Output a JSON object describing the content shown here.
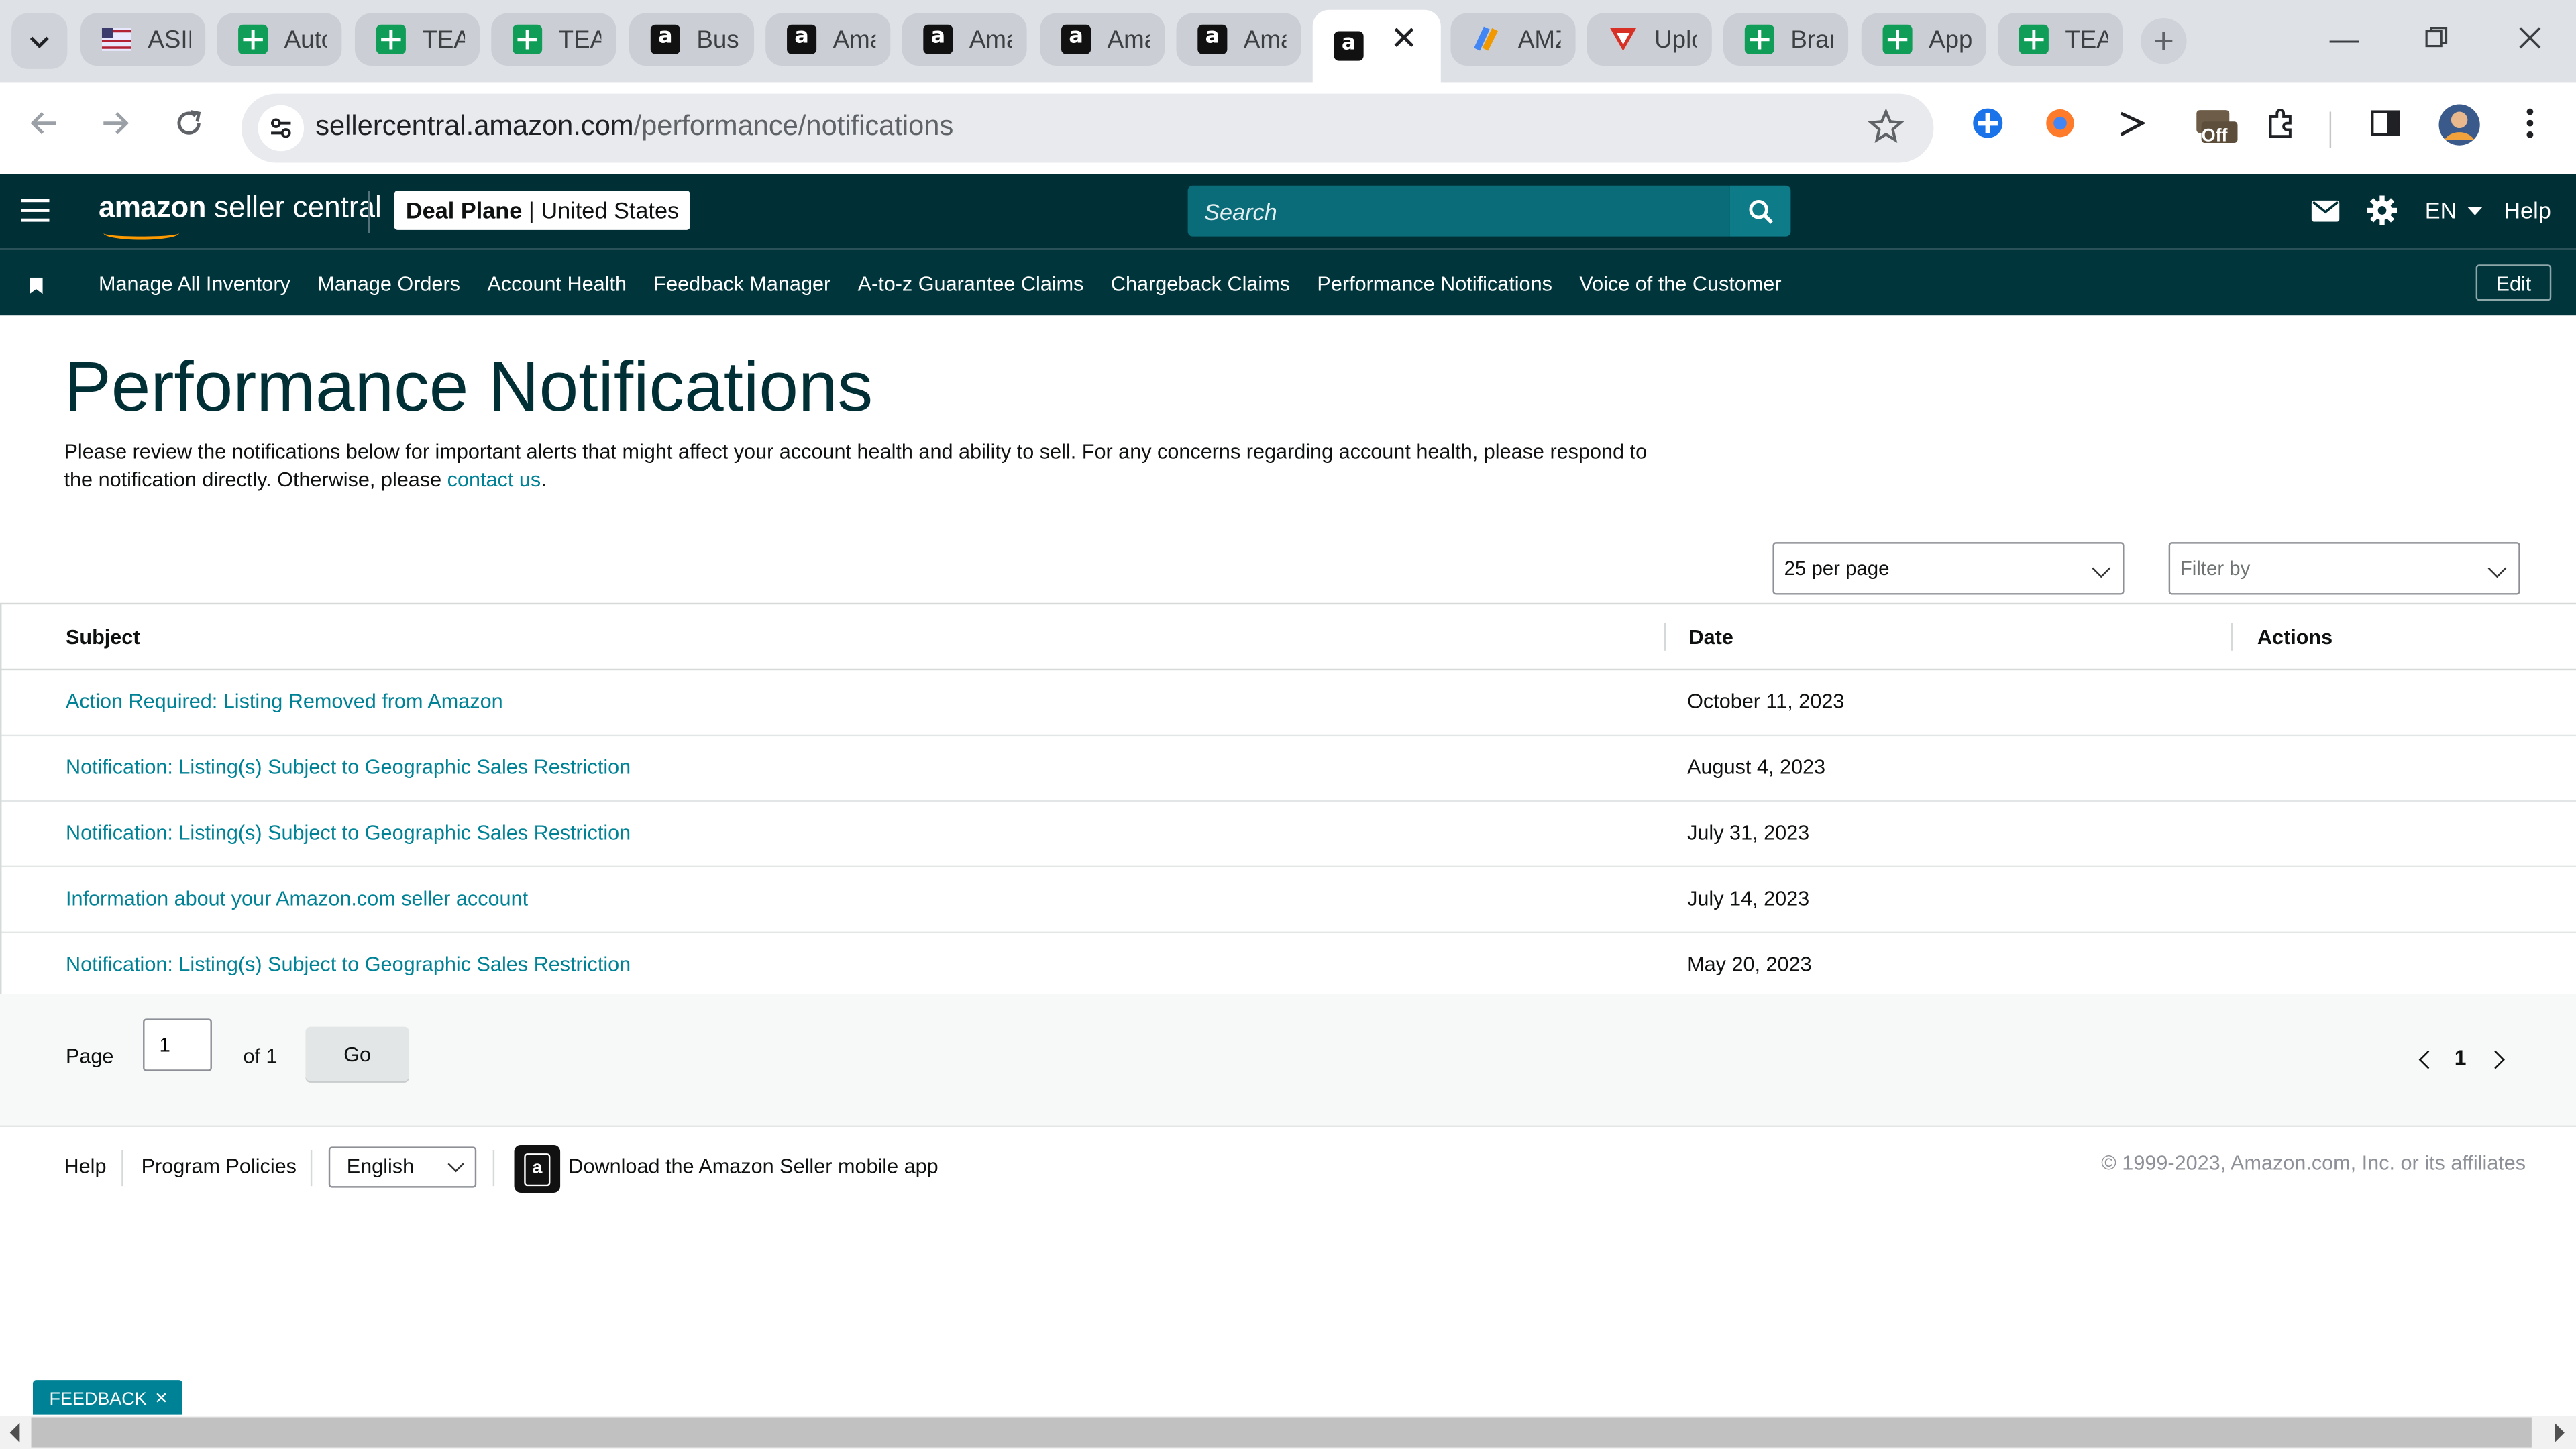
{
  "browser": {
    "tabs": [
      {
        "title": "ASIN",
        "icon": "asin-favicon-icon"
      },
      {
        "title": "Auto",
        "icon": "sheets-icon"
      },
      {
        "title": "TEAM",
        "icon": "sheets-icon"
      },
      {
        "title": "TEAM",
        "icon": "sheets-icon"
      },
      {
        "title": "Busi",
        "icon": "amazon-icon"
      },
      {
        "title": "Ama",
        "icon": "amazon-icon"
      },
      {
        "title": "Ama",
        "icon": "amazon-icon"
      },
      {
        "title": "Ama",
        "icon": "amazon-icon"
      },
      {
        "title": "Ama",
        "icon": "amazon-icon"
      },
      {
        "title": "",
        "icon": "amazon-icon",
        "active": true
      },
      {
        "title": "AMZ",
        "icon": "app-icon"
      },
      {
        "title": "Uplo",
        "icon": "upload-icon"
      },
      {
        "title": "Bran",
        "icon": "sheets-icon"
      },
      {
        "title": "App",
        "icon": "sheets-icon"
      },
      {
        "title": "TEAM",
        "icon": "sheets-icon"
      }
    ],
    "url_host": "sellercentral.amazon.com",
    "url_path": "/performance/notifications",
    "extension_badge": "Off"
  },
  "header": {
    "logo_bold": "amazon",
    "logo_light": "seller central",
    "account_name": "Deal Plane",
    "marketplace": "United States",
    "search_placeholder": "Search",
    "language": "EN",
    "help": "Help"
  },
  "nav": {
    "items": [
      "Manage All Inventory",
      "Manage Orders",
      "Account Health",
      "Feedback Manager",
      "A-to-z Guarantee Claims",
      "Chargeback Claims",
      "Performance Notifications",
      "Voice of the Customer"
    ],
    "edit_label": "Edit"
  },
  "page": {
    "title": "Performance Notifications",
    "intro": "Please review the notifications below for important alerts that might affect your account health and ability to sell. For any concerns regarding account health, please respond to the notification directly. Otherwise, please ",
    "contact_link": "contact us",
    "intro_end": ".",
    "per_page": "25 per page",
    "filter_placeholder": "Filter by"
  },
  "table": {
    "columns": {
      "subject": "Subject",
      "date": "Date",
      "actions": "Actions"
    },
    "rows": [
      {
        "subject": "Action Required: Listing Removed from Amazon",
        "date": "October 11, 2023"
      },
      {
        "subject": "Notification: Listing(s) Subject to Geographic Sales Restriction",
        "date": "August 4, 2023"
      },
      {
        "subject": "Notification: Listing(s) Subject to Geographic Sales Restriction",
        "date": "July 31, 2023"
      },
      {
        "subject": "Information about your Amazon.com seller account",
        "date": "July 14, 2023"
      },
      {
        "subject": "Notification: Listing(s) Subject to Geographic Sales Restriction",
        "date": "May 20, 2023"
      }
    ]
  },
  "pagination": {
    "page_label": "Page",
    "current": "1",
    "of_label": "of 1",
    "go": "Go",
    "page_number": "1"
  },
  "footer": {
    "help": "Help",
    "policies": "Program Policies",
    "language": "English",
    "app_text": "Download the Amazon Seller mobile app",
    "copyright": "© 1999-2023, Amazon.com, Inc. or its affiliates"
  },
  "feedback": {
    "label": "FEEDBACK",
    "close": "×"
  },
  "colors": {
    "header_bg": "#002f36",
    "nav_bg": "#00353c",
    "link": "#008296",
    "accent": "#ff9900"
  }
}
